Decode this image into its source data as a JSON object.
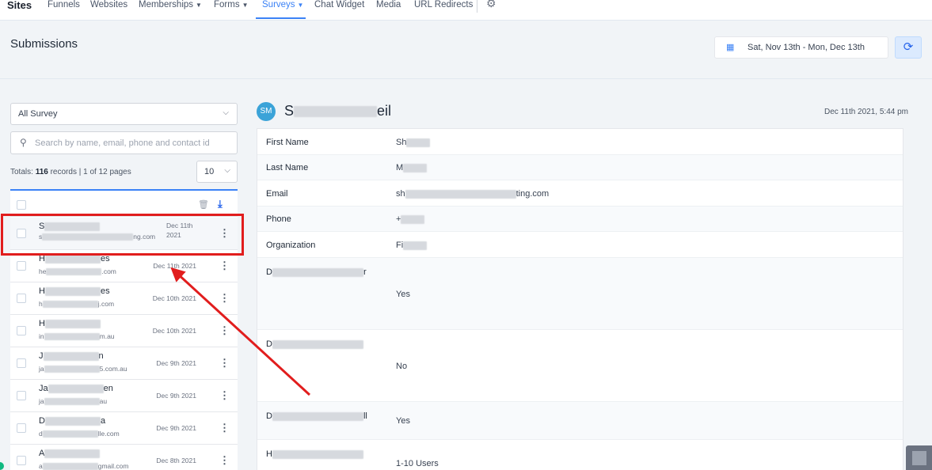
{
  "nav": {
    "brand": "Sites",
    "items": [
      {
        "label": "Funnels",
        "caret": false
      },
      {
        "label": "Websites",
        "caret": false
      },
      {
        "label": "Memberships",
        "caret": true
      },
      {
        "label": "Forms",
        "caret": true
      },
      {
        "label": "Surveys",
        "caret": true,
        "active": true
      },
      {
        "label": "Chat Widget",
        "caret": false
      },
      {
        "label": "Media",
        "caret": false
      },
      {
        "label": "URL Redirects",
        "caret": false
      }
    ],
    "settings_icon": "gear-icon"
  },
  "header": {
    "title": "Submissions",
    "date_range": "Sat, Nov 13th - Mon, Dec 13th",
    "refresh_icon": "refresh-icon",
    "calendar_icon": "calendar-icon"
  },
  "filters": {
    "survey_select": "All Survey",
    "search_placeholder": "Search by name, email, phone and contact id",
    "totals_prefix": "Totals: ",
    "totals_count": "116",
    "totals_suffix": " records | 1 of 12 pages",
    "page_size": "10"
  },
  "submissions": [
    {
      "name_start": "S",
      "name_end": "",
      "email_start": "s",
      "email_end": "ng.com",
      "date": "Dec 11th 2021",
      "selected": true
    },
    {
      "name_start": "H",
      "name_end": "es",
      "email_start": "he",
      "email_end": ".com",
      "date": "Dec 11th 2021",
      "selected": false
    },
    {
      "name_start": "H",
      "name_end": "es",
      "email_start": "h",
      "email_end": "j.com",
      "date": "Dec 10th 2021",
      "selected": false
    },
    {
      "name_start": "H",
      "name_end": "",
      "email_start": "in",
      "email_end": "m.au",
      "date": "Dec 10th 2021",
      "selected": false
    },
    {
      "name_start": "J",
      "name_end": "n",
      "email_start": "ja",
      "email_end": "5.com.au",
      "date": "Dec 9th 2021",
      "selected": false
    },
    {
      "name_start": "Ja",
      "name_end": "en",
      "email_start": "ja",
      "email_end": "au",
      "date": "Dec 9th 2021",
      "selected": false
    },
    {
      "name_start": "D",
      "name_end": "a",
      "email_start": "d",
      "email_end": "lle.com",
      "date": "Dec 9th 2021",
      "selected": false
    },
    {
      "name_start": "A",
      "name_end": "",
      "email_start": "a",
      "email_end": "gmail.com",
      "date": "Dec 8th 2021",
      "selected": false
    }
  ],
  "detail": {
    "avatar_initials": "SM",
    "name_start": "S",
    "name_end": "eil",
    "submitted_at": "Dec 11th 2021, 5:44 pm",
    "fields": [
      {
        "label": "First Name",
        "value_start": "Sh",
        "value_end": ""
      },
      {
        "label": "Last Name",
        "value_start": "M",
        "value_end": ""
      },
      {
        "label": "Email",
        "value_start": "sh",
        "value_end": "ting.com"
      },
      {
        "label": "Phone",
        "value_start": "+",
        "value_end": ""
      },
      {
        "label": "Organization",
        "value_start": "Fi",
        "value_end": ""
      },
      {
        "label": "D",
        "label_end": "r",
        "value_start": "Yes",
        "value_end": ""
      },
      {
        "label": "D",
        "label_end": "",
        "value_start": "No",
        "value_end": ""
      },
      {
        "label": "D",
        "label_end": "ll",
        "value_start": "Yes",
        "value_end": ""
      },
      {
        "label": "H",
        "label_end": "",
        "value_start": "1-10 Users",
        "value_end": ""
      }
    ]
  },
  "annotations": {
    "highlight_color": "#e11d1d"
  }
}
